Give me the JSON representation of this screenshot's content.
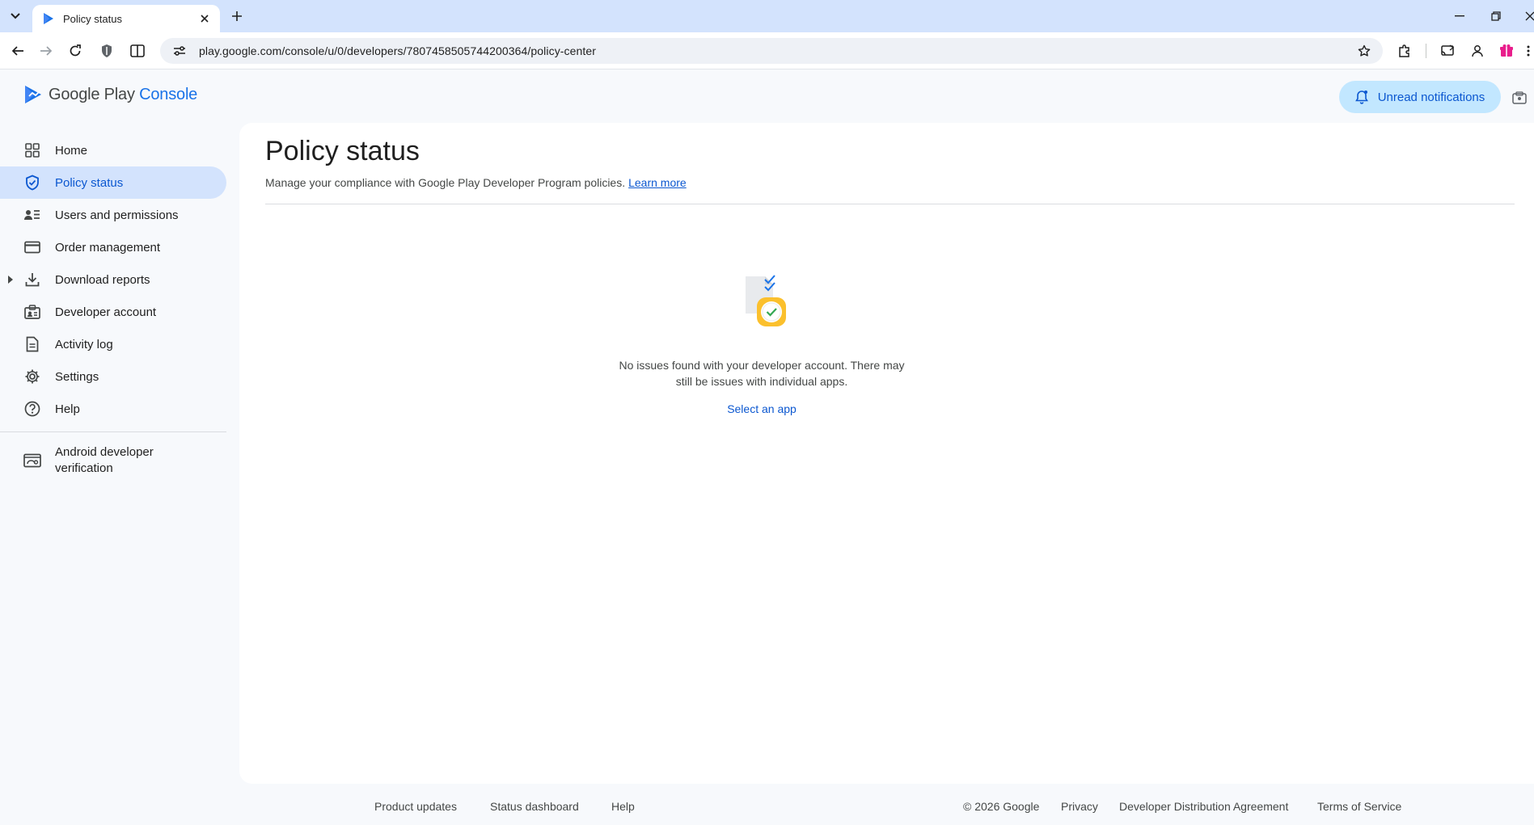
{
  "browser": {
    "tab_title": "Policy status",
    "url": "play.google.com/console/u/0/developers/7807458505744200364/policy-center"
  },
  "header": {
    "brand_main": "Google Play",
    "brand_console": "Console",
    "unread_label": "Unread notifications"
  },
  "sidebar": {
    "items": [
      {
        "label": "Home"
      },
      {
        "label": "Policy status"
      },
      {
        "label": "Users and permissions"
      },
      {
        "label": "Order management"
      },
      {
        "label": "Download reports"
      },
      {
        "label": "Developer account"
      },
      {
        "label": "Activity log"
      },
      {
        "label": "Settings"
      },
      {
        "label": "Help"
      },
      {
        "label": "Android developer verification"
      }
    ],
    "active_index": 1
  },
  "main": {
    "title": "Policy status",
    "subtitle": "Manage your compliance with Google Play Developer Program policies.",
    "learn_more": "Learn more",
    "empty_message": "No issues found with your developer account. There may still be issues with individual apps.",
    "select_app": "Select an app"
  },
  "footer": {
    "product_updates": "Product updates",
    "status_dashboard": "Status dashboard",
    "help": "Help",
    "copyright": "© 2026 Google",
    "privacy": "Privacy",
    "dda": "Developer Distribution Agreement",
    "tos": "Terms of Service"
  },
  "colors": {
    "accent": "#0b57d0",
    "active_nav_bg": "#d3e3fd",
    "tabbar_bg": "#d3e3fd",
    "unread_bg": "#c2e7ff"
  }
}
